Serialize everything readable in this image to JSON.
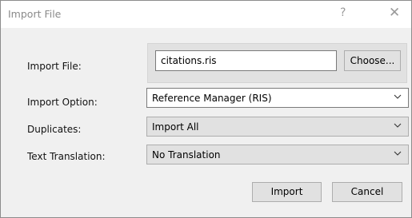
{
  "window": {
    "title": "Import File",
    "help_glyph": "?",
    "close_glyph": "✕"
  },
  "form": {
    "file_label": "Import File:",
    "file_value": "citations.ris",
    "choose_label": "Choose...",
    "option_label": "Import Option:",
    "option_value": "Reference Manager (RIS)",
    "duplicates_label": "Duplicates:",
    "duplicates_value": "Import All",
    "translation_label": "Text Translation:",
    "translation_value": "No Translation"
  },
  "buttons": {
    "import_label": "Import",
    "cancel_label": "Cancel"
  },
  "icons": {
    "dropdown": "chevron-down-icon"
  }
}
